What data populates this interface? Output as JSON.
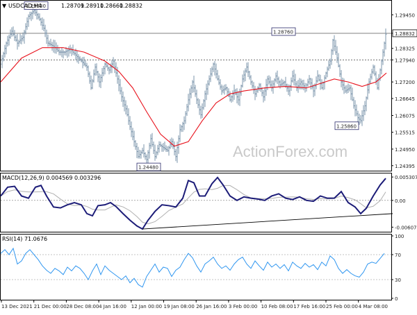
{
  "chart_data": [
    {
      "type": "candlestick",
      "header": {
        "symbol_timeframe": "USDCAD,H4",
        "open": "1.28709",
        "high": "1.28910",
        "low": "1.28660",
        "close": "1.28832"
      },
      "watermark": "ActionForex.com",
      "y_ticks": [
        "1.29450",
        "1.28832",
        "1.28325",
        "1.27940",
        "1.27200",
        "1.26645",
        "1.26075",
        "1.25515",
        "1.24950",
        "1.24395"
      ],
      "ylim": [
        1.2425,
        1.299
      ],
      "current_price": "1.28832",
      "hlines": [
        {
          "value": 1.2883,
          "label": "1.28832",
          "style": "solid"
        },
        {
          "value": 1.2794,
          "label": "1.27940",
          "style": "dashed"
        }
      ],
      "annotations": [
        {
          "text": "1.29630",
          "x": 35,
          "y": 1.2963,
          "anchor": "left"
        },
        {
          "text": "1.28760",
          "x": 425,
          "y": 1.2876,
          "anchor": "right"
        },
        {
          "text": "1.25860",
          "x": 482,
          "y": 1.2586,
          "anchor": "left"
        },
        {
          "text": "1.24480",
          "x": 197,
          "y": 1.2448,
          "anchor": "left"
        }
      ],
      "moving_average": {
        "color": "#e8111b",
        "points": [
          [
            0,
            1.272
          ],
          [
            30,
            1.28
          ],
          [
            60,
            1.2835
          ],
          [
            90,
            1.2835
          ],
          [
            120,
            1.282
          ],
          [
            150,
            1.279
          ],
          [
            170,
            1.2755
          ],
          [
            190,
            1.27
          ],
          [
            210,
            1.262
          ],
          [
            230,
            1.2545
          ],
          [
            250,
            1.2505
          ],
          [
            270,
            1.252
          ],
          [
            290,
            1.259
          ],
          [
            310,
            1.265
          ],
          [
            330,
            1.268
          ],
          [
            350,
            1.269
          ],
          [
            380,
            1.27
          ],
          [
            410,
            1.2705
          ],
          [
            440,
            1.27
          ],
          [
            460,
            1.2715
          ],
          [
            480,
            1.273
          ],
          [
            500,
            1.272
          ],
          [
            520,
            1.2705
          ],
          [
            540,
            1.272
          ],
          [
            555,
            1.275
          ]
        ]
      },
      "price_path": [
        [
          0,
          1.278
        ],
        [
          8,
          1.285
        ],
        [
          16,
          1.289
        ],
        [
          24,
          1.285
        ],
        [
          32,
          1.287
        ],
        [
          40,
          1.294
        ],
        [
          48,
          1.296
        ],
        [
          56,
          1.293
        ],
        [
          62,
          1.29
        ],
        [
          68,
          1.285
        ],
        [
          76,
          1.284
        ],
        [
          84,
          1.282
        ],
        [
          92,
          1.282
        ],
        [
          100,
          1.283
        ],
        [
          108,
          1.281
        ],
        [
          116,
          1.279
        ],
        [
          124,
          1.277
        ],
        [
          130,
          1.27
        ],
        [
          136,
          1.277
        ],
        [
          142,
          1.272
        ],
        [
          150,
          1.278
        ],
        [
          156,
          1.276
        ],
        [
          162,
          1.279
        ],
        [
          168,
          1.273
        ],
        [
          174,
          1.267
        ],
        [
          180,
          1.263
        ],
        [
          186,
          1.257
        ],
        [
          192,
          1.252
        ],
        [
          198,
          1.247
        ],
        [
          204,
          1.249
        ],
        [
          210,
          1.246
        ],
        [
          216,
          1.253
        ],
        [
          222,
          1.247
        ],
        [
          228,
          1.251
        ],
        [
          234,
          1.25
        ],
        [
          240,
          1.249
        ],
        [
          246,
          1.252
        ],
        [
          252,
          1.247
        ],
        [
          258,
          1.256
        ],
        [
          264,
          1.259
        ],
        [
          270,
          1.266
        ],
        [
          276,
          1.272
        ],
        [
          282,
          1.266
        ],
        [
          288,
          1.261
        ],
        [
          294,
          1.268
        ],
        [
          300,
          1.273
        ],
        [
          306,
          1.278
        ],
        [
          312,
          1.273
        ],
        [
          318,
          1.269
        ],
        [
          324,
          1.27
        ],
        [
          330,
          1.266
        ],
        [
          336,
          1.269
        ],
        [
          342,
          1.266
        ],
        [
          348,
          1.273
        ],
        [
          354,
          1.277
        ],
        [
          360,
          1.272
        ],
        [
          366,
          1.268
        ],
        [
          372,
          1.271
        ],
        [
          378,
          1.267
        ],
        [
          384,
          1.273
        ],
        [
          390,
          1.27
        ],
        [
          396,
          1.274
        ],
        [
          402,
          1.271
        ],
        [
          408,
          1.272
        ],
        [
          414,
          1.269
        ],
        [
          420,
          1.274
        ],
        [
          426,
          1.27
        ],
        [
          432,
          1.272
        ],
        [
          438,
          1.27
        ],
        [
          444,
          1.273
        ],
        [
          450,
          1.269
        ],
        [
          456,
          1.274
        ],
        [
          462,
          1.27
        ],
        [
          468,
          1.275
        ],
        [
          474,
          1.279
        ],
        [
          478,
          1.286
        ],
        [
          484,
          1.28
        ],
        [
          490,
          1.272
        ],
        [
          496,
          1.269
        ],
        [
          502,
          1.27
        ],
        [
          508,
          1.264
        ],
        [
          514,
          1.26
        ],
        [
          518,
          1.259
        ],
        [
          524,
          1.264
        ],
        [
          530,
          1.272
        ],
        [
          536,
          1.277
        ],
        [
          542,
          1.27
        ],
        [
          546,
          1.276
        ],
        [
          550,
          1.282
        ],
        [
          554,
          1.288
        ]
      ],
      "ohlc_bar_color": "#7b94ab"
    },
    {
      "type": "line",
      "title": "MACD(12,26,9) 0.004569 0.003296",
      "y_ticks": [
        "0.005307",
        "0.00",
        "-0.006074"
      ],
      "ylim": [
        -0.0068,
        0.0058
      ],
      "macd_color": "#1c1c78",
      "signal_color": "#b0b0b0",
      "zero_line": 0.0,
      "macd_points": [
        [
          0,
          0.001
        ],
        [
          10,
          0.003
        ],
        [
          20,
          0.0032
        ],
        [
          30,
          0.001
        ],
        [
          40,
          0.0005
        ],
        [
          50,
          0.003
        ],
        [
          58,
          0.0034
        ],
        [
          66,
          0.001
        ],
        [
          76,
          -0.0015
        ],
        [
          86,
          -0.0017
        ],
        [
          96,
          -0.001
        ],
        [
          106,
          -0.0005
        ],
        [
          116,
          -0.001
        ],
        [
          124,
          -0.003
        ],
        [
          132,
          -0.0035
        ],
        [
          140,
          -0.0012
        ],
        [
          150,
          -0.001
        ],
        [
          158,
          -0.0005
        ],
        [
          166,
          -0.0014
        ],
        [
          176,
          -0.003
        ],
        [
          186,
          -0.0045
        ],
        [
          196,
          -0.0058
        ],
        [
          204,
          -0.0065
        ],
        [
          212,
          -0.0045
        ],
        [
          222,
          -0.0025
        ],
        [
          232,
          -0.001
        ],
        [
          242,
          -0.0012
        ],
        [
          252,
          -0.0015
        ],
        [
          262,
          0.0005
        ],
        [
          270,
          0.0045
        ],
        [
          278,
          0.004
        ],
        [
          286,
          0.001
        ],
        [
          294,
          0.001
        ],
        [
          304,
          0.0038
        ],
        [
          312,
          0.0052
        ],
        [
          320,
          0.0035
        ],
        [
          330,
          0.001
        ],
        [
          340,
          0.0
        ],
        [
          350,
          0.0008
        ],
        [
          360,
          0.0005
        ],
        [
          370,
          0.0003
        ],
        [
          380,
          0.0
        ],
        [
          390,
          0.001
        ],
        [
          400,
          0.0015
        ],
        [
          410,
          0.0005
        ],
        [
          420,
          0.0002
        ],
        [
          430,
          0.0008
        ],
        [
          440,
          0.0
        ],
        [
          450,
          -0.0002
        ],
        [
          460,
          0.001
        ],
        [
          470,
          0.0005
        ],
        [
          480,
          0.0005
        ],
        [
          490,
          0.002
        ],
        [
          500,
          -0.0005
        ],
        [
          510,
          -0.0015
        ],
        [
          518,
          -0.003
        ],
        [
          526,
          -0.0018
        ],
        [
          536,
          0.001
        ],
        [
          546,
          0.0035
        ],
        [
          554,
          0.005
        ]
      ],
      "trendline": [
        [
          205,
          -0.0065
        ],
        [
          565,
          -0.003
        ]
      ]
    },
    {
      "type": "line",
      "title": "RSI(14) 71.0676",
      "y_ticks": [
        "100",
        "70",
        "30",
        "0"
      ],
      "ylim": [
        0,
        100
      ],
      "line_color": "#2f96f0",
      "guide_levels": [
        70,
        30
      ],
      "points": [
        [
          0,
          72
        ],
        [
          6,
          78
        ],
        [
          12,
          70
        ],
        [
          18,
          80
        ],
        [
          24,
          55
        ],
        [
          30,
          60
        ],
        [
          36,
          72
        ],
        [
          42,
          78
        ],
        [
          48,
          70
        ],
        [
          54,
          62
        ],
        [
          60,
          52
        ],
        [
          66,
          45
        ],
        [
          72,
          40
        ],
        [
          78,
          48
        ],
        [
          84,
          44
        ],
        [
          90,
          38
        ],
        [
          96,
          50
        ],
        [
          102,
          44
        ],
        [
          108,
          52
        ],
        [
          114,
          48
        ],
        [
          120,
          40
        ],
        [
          126,
          30
        ],
        [
          132,
          44
        ],
        [
          138,
          55
        ],
        [
          144,
          38
        ],
        [
          150,
          52
        ],
        [
          156,
          45
        ],
        [
          162,
          40
        ],
        [
          168,
          35
        ],
        [
          174,
          30
        ],
        [
          180,
          36
        ],
        [
          186,
          25
        ],
        [
          192,
          32
        ],
        [
          198,
          22
        ],
        [
          204,
          18
        ],
        [
          210,
          35
        ],
        [
          216,
          45
        ],
        [
          222,
          55
        ],
        [
          228,
          42
        ],
        [
          234,
          50
        ],
        [
          240,
          48
        ],
        [
          246,
          35
        ],
        [
          252,
          45
        ],
        [
          258,
          50
        ],
        [
          264,
          62
        ],
        [
          270,
          72
        ],
        [
          276,
          65
        ],
        [
          282,
          52
        ],
        [
          288,
          42
        ],
        [
          294,
          55
        ],
        [
          300,
          60
        ],
        [
          306,
          66
        ],
        [
          312,
          55
        ],
        [
          318,
          48
        ],
        [
          324,
          52
        ],
        [
          330,
          45
        ],
        [
          336,
          55
        ],
        [
          342,
          62
        ],
        [
          348,
          66
        ],
        [
          354,
          55
        ],
        [
          360,
          48
        ],
        [
          366,
          60
        ],
        [
          372,
          52
        ],
        [
          378,
          45
        ],
        [
          384,
          58
        ],
        [
          390,
          50
        ],
        [
          396,
          55
        ],
        [
          402,
          48
        ],
        [
          408,
          54
        ],
        [
          414,
          44
        ],
        [
          420,
          58
        ],
        [
          426,
          52
        ],
        [
          432,
          48
        ],
        [
          438,
          56
        ],
        [
          444,
          50
        ],
        [
          450,
          54
        ],
        [
          456,
          46
        ],
        [
          462,
          58
        ],
        [
          468,
          52
        ],
        [
          474,
          68
        ],
        [
          480,
          62
        ],
        [
          486,
          48
        ],
        [
          492,
          40
        ],
        [
          498,
          46
        ],
        [
          504,
          40
        ],
        [
          510,
          36
        ],
        [
          516,
          34
        ],
        [
          522,
          42
        ],
        [
          528,
          55
        ],
        [
          534,
          58
        ],
        [
          540,
          56
        ],
        [
          546,
          64
        ],
        [
          552,
          72
        ]
      ]
    }
  ],
  "x_axis_labels": [
    "13 Dec 2021",
    "21 Dec 00:00",
    "28 Dec 08:00",
    "4 Jan 16:00",
    "12 Jan 00:00",
    "19 Jan 08:00",
    "26 Jan 16:00",
    "3 Feb 00:00",
    "10 Feb 08:00",
    "17 Feb 16:00",
    "25 Feb 00:00",
    "4 Mar 08:00"
  ]
}
